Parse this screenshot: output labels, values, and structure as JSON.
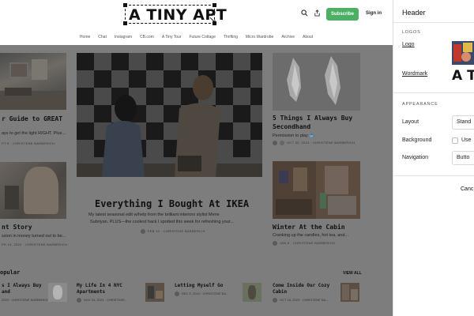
{
  "site": {
    "logo_text": "A TINY APT",
    "subscribe_label": "Subscribe",
    "signin_label": "Sign in",
    "nav": [
      "Home",
      "Chat",
      "Instagram",
      "CB.com",
      "A Tiny Tour",
      "Future Cottage",
      "Thrifting",
      "Micro Wardrobe",
      "Archive",
      "About"
    ]
  },
  "cards": {
    "left_top": {
      "title": "r Guide to GREAT",
      "desc": "ays to get the light RIGHT. Plus...",
      "meta": "PT 5 · CHRISTENE BARBERICH"
    },
    "left_bottom": {
      "title": "nt Story",
      "desc": "ssion in money turned out to be...",
      "meta": "PR 15, 2022 · CHRISTENE BARBERICH"
    },
    "feature": {
      "title": "Everything I Bought At IKEA",
      "desc_line1": "My latest seasonal edit w/help from the brilliant interiors stylist Merie",
      "desc_line2": "Subriyan. PLUS—the coolest hack I spotted this week for refreshing your...",
      "meta": "FEB 10 · CHRISTENE BARBERICH"
    },
    "right_top": {
      "title_line1": "5 Things I Always Buy",
      "title_line2": "Secondhand",
      "desc": "Permission to play 🐟",
      "meta": "OCT 30, 2023 · CHRISTENE BARBERICH"
    },
    "right_bottom": {
      "title": "Winter At the Cabin",
      "desc": "Cranking up the candles, hot tea, and...",
      "meta": "JAN 8 · CHRISTENE BARBERICH"
    }
  },
  "popular": {
    "header": "opular",
    "view_all": "VIEW ALL",
    "items": [
      {
        "title_line1": "s I Always Buy",
        "title_line2": "and",
        "meta": "2023 · CHRISTENE BARBERICH"
      },
      {
        "title_line1": "My Life In 4 NYC",
        "title_line2": "Apartments",
        "meta": "NOV 20, 2024 · CHRISTENE..."
      },
      {
        "title_line1": "Letting Myself Go",
        "title_line2": "",
        "meta": "DEC 9, 2024 · CHRISTENE BA..."
      },
      {
        "title_line1": "Come Inside Our Cozy",
        "title_line2": "Cabin",
        "meta": "OCT 16, 2023 · CHRISTENE BA..."
      }
    ]
  },
  "panel": {
    "title": "Header",
    "logos_section": "LOGOS",
    "logo_label": "Logo",
    "wordmark_label": "Wordmark",
    "wordmark_preview": "A TI",
    "appearance_section": "APPEARANCE",
    "layout_label": "Layout",
    "layout_value": "Stand",
    "background_label": "Background",
    "background_value": "Use",
    "navigation_label": "Navigation",
    "navigation_value": "Butto",
    "cancel_label": "Canc"
  },
  "colors": {
    "subscribe_green": "#4caf64",
    "overlay_gray": "#7d7d7d"
  }
}
